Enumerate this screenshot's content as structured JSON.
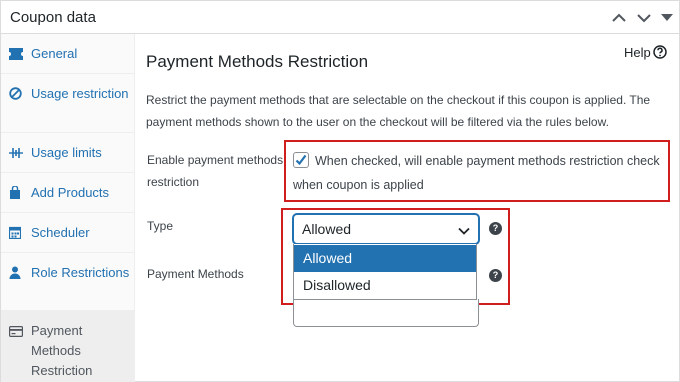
{
  "panel": {
    "title": "Coupon data"
  },
  "sidebar": {
    "items": [
      {
        "label": "General",
        "icon": "ticket-icon"
      },
      {
        "label": "Usage restriction",
        "icon": "block-icon"
      },
      {
        "label": "Usage limits",
        "icon": "limits-icon"
      },
      {
        "label": "Add Products",
        "icon": "bag-icon"
      },
      {
        "label": "Scheduler",
        "icon": "calendar-icon"
      },
      {
        "label": "Role Restrictions",
        "icon": "user-icon"
      },
      {
        "label": "Payment Methods Restriction",
        "icon": "card-icon"
      }
    ]
  },
  "main": {
    "title": "Payment Methods Restriction",
    "help": "Help",
    "description": "Restrict the payment methods that are selectable on the checkout if this coupon is applied. The payment methods shown to the user on the checkout will be filtered via the rules below.",
    "enable_label": "Enable payment methods restriction",
    "enable_checked": true,
    "enable_text": "When checked, will enable payment methods restriction check when coupon is applied",
    "type_label": "Type",
    "type_value": "Allowed",
    "type_options": [
      "Allowed",
      "Disallowed"
    ],
    "payment_methods_label": "Payment Methods"
  },
  "colors": {
    "accent": "#2271b1",
    "highlight_box": "#d01e1e",
    "link": "#2271b1"
  }
}
